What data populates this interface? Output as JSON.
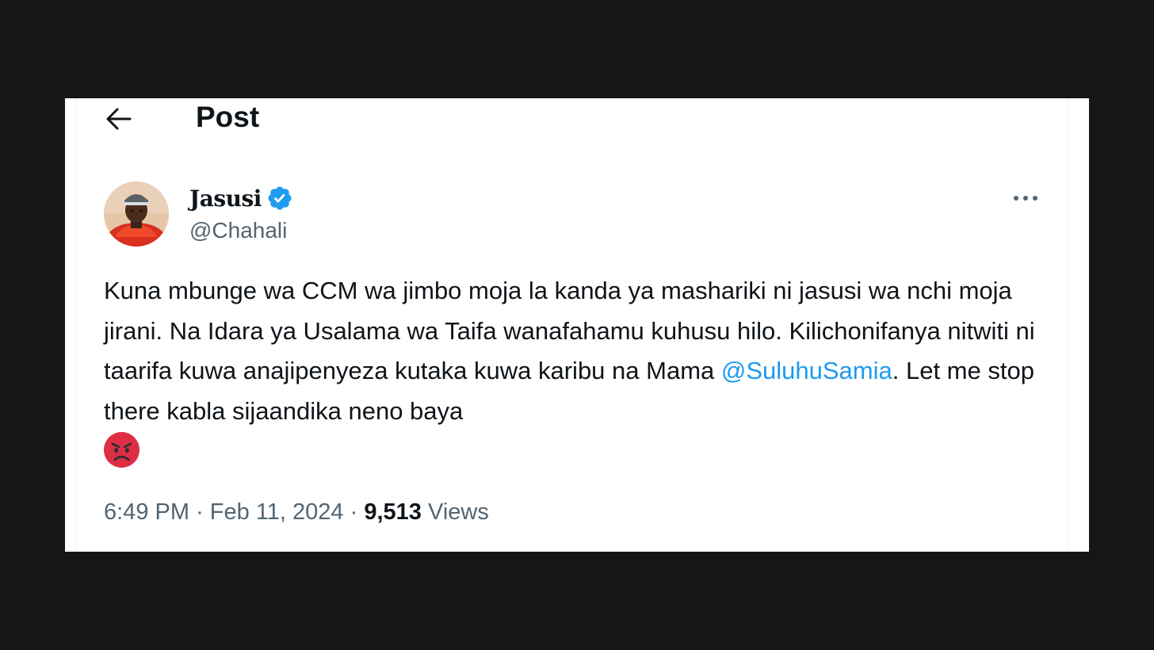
{
  "header": {
    "title": "Post",
    "back_icon": "arrow-left-icon"
  },
  "author": {
    "display_name": "Jasusi",
    "handle": "@Chahali",
    "verified_icon": "verified-badge-icon",
    "verified_color": "#1d9bf0"
  },
  "more_icon": "more-horizontal-icon",
  "tweet": {
    "text_before_mention": "Kuna mbunge wa CCM wa jimbo moja la kanda ya mashariki ni jasusi wa nchi moja jirani. Na Idara ya Usalama wa Taifa wanafahamu kuhusu hilo. Kilichonifanya nitwiti ni taarifa kuwa anajipenyeza kutaka kuwa karibu na Mama ",
    "mention": "@SuluhuSamia",
    "text_after_mention": ". Let me stop there kabla sijaandika neno baya",
    "emoji": "angry-face-icon"
  },
  "meta": {
    "time": "6:49 PM",
    "separator": "·",
    "date": "Feb 11, 2024",
    "views_count": "9,513",
    "views_label": "Views"
  },
  "colors": {
    "text_primary": "#0f1419",
    "text_secondary": "#536471",
    "link": "#1d9bf0",
    "background_outer": "#161616"
  }
}
